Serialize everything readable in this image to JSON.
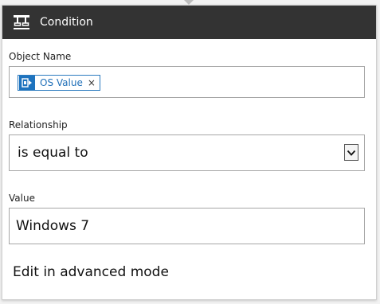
{
  "header": {
    "title": "Condition",
    "icon": "condition-icon",
    "background": "#333333"
  },
  "object_name": {
    "label": "Object Name",
    "token": {
      "label": "OS Value",
      "remove_glyph": "×",
      "icon": "dynamic-content-icon",
      "accent": "#1e73be"
    }
  },
  "relationship": {
    "label": "Relationship",
    "selected": "is equal to"
  },
  "value": {
    "label": "Value",
    "text": "Windows 7"
  },
  "advanced_mode": {
    "label": "Edit in advanced mode"
  }
}
